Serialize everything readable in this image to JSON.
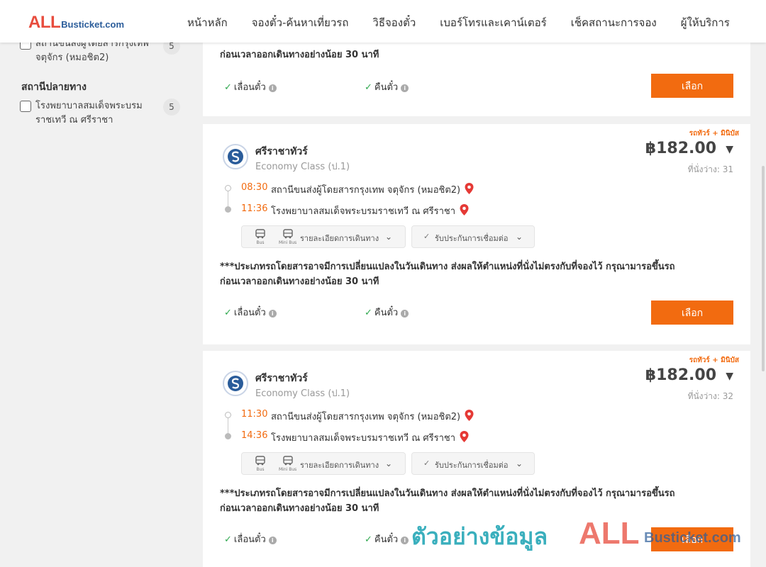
{
  "header": {
    "logo_all": "ALL",
    "logo_rest": "Busticket.com",
    "nav": [
      "หน้าหลัก",
      "จองตั๋ว-ค้นหาเที่ยวรถ",
      "วิธีจองตั๋ว",
      "เบอร์โทรและเคาน์เตอร์",
      "เช็คสถานะการจอง",
      "ผู้ให้บริการ"
    ]
  },
  "sidebar": {
    "origin_item": {
      "label": "สถานีขนส่งผู้โดยสารกรุงเทพ จตุจักร (หมอชิต2)",
      "count": "5"
    },
    "destination_title": "สถานีปลายทาง",
    "destination_item": {
      "label": "โรงพยาบาลสมเด็จพระบรมราชเทวี ณ ศรีราชา",
      "count": "5"
    }
  },
  "top_card": {
    "notice_fragment": "ก่อนเวลาออกเดินทางอย่างน้อย 30 นาที",
    "refund_label": "เลื่อนตั๋ว",
    "return_label": "คืนตั๋ว",
    "select_label": "เลือก"
  },
  "trips": [
    {
      "tag": "รถทัวร์ + มินิบัส",
      "operator": "ศรีราชาทัวร์",
      "class": "Economy Class (ป.1)",
      "price": "฿182.00",
      "seats": "ที่นั่งว่าง: 31",
      "depart_time": "08:30",
      "depart_station": "สถานีขนส่งผู้โดยสารกรุงเทพ จตุจักร (หมอชิต2)",
      "arrive_time": "11:36",
      "arrive_station": "โรงพยาบาลสมเด็จพระบรมราชเทวี ณ ศรีราชา",
      "bus_label": "Bus",
      "minibus_label": "Mini Bus",
      "detail_label": "รายละเอียดการเดินทาง",
      "guarantee_label": "รับประกันการเชื่อมต่อ",
      "notice_line1": "***ประเภทรถโดยสารอาจมีการเปลี่ยนแปลงในวันเดินทาง ส่งผลให้ตำแหน่งที่นั่งไม่ตรงกับที่จองไว้ กรุณามารอขึ้นรถ",
      "notice_line2": "ก่อนเวลาออกเดินทางอย่างน้อย 30 นาที",
      "reschedule_label": "เลื่อนตั๋ว",
      "refund_label": "คืนตั๋ว",
      "select_label": "เลือก"
    },
    {
      "tag": "รถทัวร์ + มินิบัส",
      "operator": "ศรีราชาทัวร์",
      "class": "Economy Class (ป.1)",
      "price": "฿182.00",
      "seats": "ที่นั่งว่าง: 32",
      "depart_time": "11:30",
      "depart_station": "สถานีขนส่งผู้โดยสารกรุงเทพ จตุจักร (หมอชิต2)",
      "arrive_time": "14:36",
      "arrive_station": "โรงพยาบาลสมเด็จพระบรมราชเทวี ณ ศรีราชา",
      "bus_label": "Bus",
      "minibus_label": "Mini Bus",
      "detail_label": "รายละเอียดการเดินทาง",
      "guarantee_label": "รับประกันการเชื่อมต่อ",
      "notice_line1": "***ประเภทรถโดยสารอาจมีการเปลี่ยนแปลงในวันเดินทาง ส่งผลให้ตำแหน่งที่นั่งไม่ตรงกับที่จองไว้ กรุณามารอขึ้นรถ",
      "notice_line2": "ก่อนเวลาออกเดินทางอย่างน้อย 30 นาที",
      "reschedule_label": "เลื่อนตั๋ว",
      "refund_label": "คืนตั๋ว",
      "select_label": "เลือก"
    }
  ],
  "watermark": {
    "thai": "ตัวอย่างข้อมูล",
    "all": "ALL",
    "rest": "Busticket.com"
  },
  "colors": {
    "accent": "#f26b10",
    "check": "#2fa84f",
    "logo_red": "#e84c3d",
    "logo_blue": "#2a5c9a",
    "watermark_teal": "#2aa9b8"
  }
}
